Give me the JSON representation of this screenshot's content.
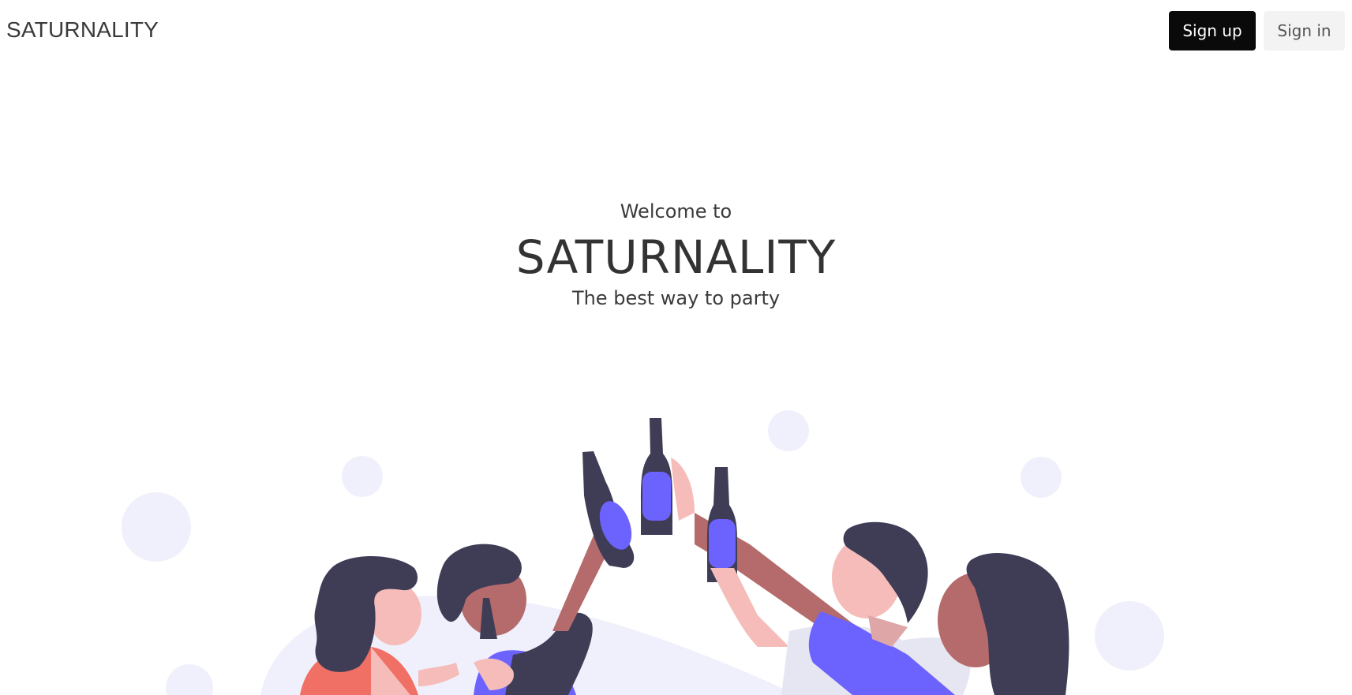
{
  "header": {
    "brand": "SATURNALITY",
    "signup_label": "Sign up",
    "signin_label": "Sign in"
  },
  "hero": {
    "welcome": "Welcome to",
    "title": "SATURNALITY",
    "tagline": "The best way to party"
  },
  "illustration": {
    "icon": "party-people-cheers-illustration",
    "colors": {
      "bubble": "#f0f0fc",
      "dark": "#3f3d56",
      "accent": "#6c63ff",
      "skin_light": "#f5bcb9",
      "skin_dark": "#b56b6b",
      "coral": "#f07065"
    }
  }
}
